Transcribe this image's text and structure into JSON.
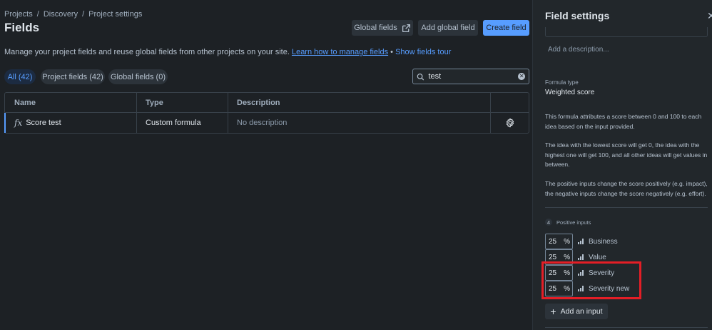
{
  "breadcrumb": {
    "items": [
      "Projects",
      "Discovery",
      "Project settings"
    ],
    "separator": "/"
  },
  "page_title": "Fields",
  "header_buttons": {
    "global_fields": "Global fields",
    "add_global_field": "Add global field",
    "create_field": "Create field"
  },
  "intro": {
    "text": "Manage your project fields and reuse global fields from other projects on your site.",
    "link": "Learn how to manage fields",
    "bullet": "•",
    "tour": "Show fields tour"
  },
  "filters": [
    {
      "label": "All (42)",
      "active": true
    },
    {
      "label": "Project fields (42)",
      "active": false
    },
    {
      "label": "Global fields (0)",
      "active": false
    }
  ],
  "search": {
    "value": "test",
    "clear_icon": "clear-icon"
  },
  "table": {
    "headers": [
      "Name",
      "Type",
      "Description"
    ],
    "rows": [
      {
        "icon": "fx",
        "name": "Score test",
        "type": "Custom formula",
        "description": "No description",
        "action_icon": "gear-icon"
      }
    ]
  },
  "panel": {
    "title": "Field settings",
    "close": "✕",
    "description_placeholder": "Add a description...",
    "formula_type_label": "Formula type",
    "formula_type_value": "Weighted score",
    "paragraphs": [
      "This formula attributes a score between 0 and 100 to each idea based on the input provided.",
      "The idea with the lowest score will get 0, the idea with the highest one will get 100, and all other ideas will get values in between.",
      "The positive inputs change the score positively (e.g. impact), the negative inputs change the score negatively (e.g. effort)."
    ],
    "positive_inputs": {
      "count": "4",
      "label": "Positive inputs",
      "items": [
        {
          "value": "25",
          "unit": "%",
          "label": "Business"
        },
        {
          "value": "25",
          "unit": "%",
          "label": "Value"
        },
        {
          "value": "25",
          "unit": "%",
          "label": "Severity"
        },
        {
          "value": "25",
          "unit": "%",
          "label": "Severity new"
        }
      ]
    },
    "add_input": "Add an input"
  },
  "colors": {
    "accent": "#579dff",
    "background": "#1d2125",
    "panel": "#22272b",
    "highlight": "#e41e26"
  }
}
